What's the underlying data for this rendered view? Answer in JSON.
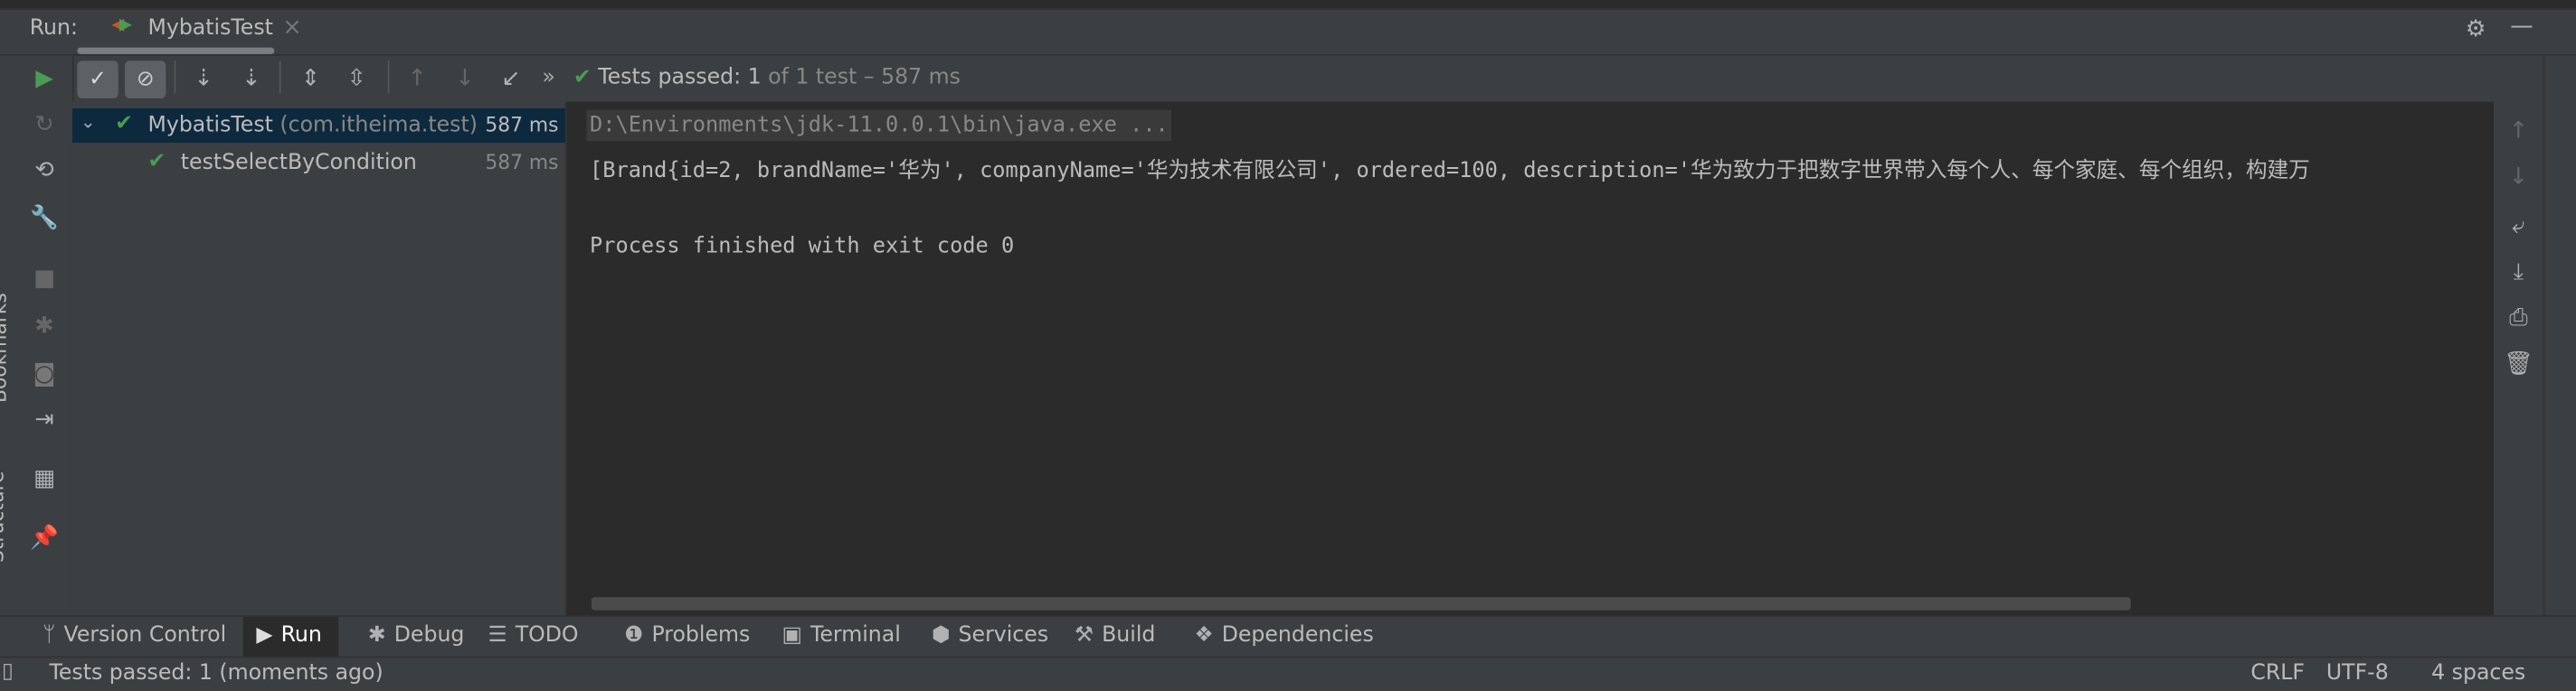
{
  "run_header": {
    "label": "Run:",
    "tab": "MybatisTest",
    "close": "×"
  },
  "toolbar": {
    "status_prefix": "Tests passed: ",
    "passed": "1",
    "status_suffix": " of 1 test – 587 ms",
    "more": "»"
  },
  "tree": [
    {
      "name": "MybatisTest",
      "pkg": " (com.itheima.test)",
      "time": "587 ms",
      "selected": true
    },
    {
      "name": "testSelectByCondition",
      "time": "587 ms"
    }
  ],
  "console": {
    "cmd": "D:\\Environments\\jdk-11.0.0.1\\bin\\java.exe ...",
    "output": "[Brand{id=2, brandName='华为', companyName='华为技术有限公司', ordered=100, description='华为致力于把数字世界带入每个人、每个家庭、每个组织，构建万",
    "exit": "Process finished with exit code 0"
  },
  "side_labels": {
    "bookmarks": "Bookmarks",
    "structure": "Structure"
  },
  "tool_windows": [
    {
      "label": "Version Control",
      "icon": "branch-icon"
    },
    {
      "label": "Run",
      "icon": "run-icon",
      "active": true
    },
    {
      "label": "Debug",
      "icon": "bug-icon"
    },
    {
      "label": "TODO",
      "icon": "list-icon"
    },
    {
      "label": "Problems",
      "icon": "problems-icon"
    },
    {
      "label": "Terminal",
      "icon": "terminal-icon"
    },
    {
      "label": "Services",
      "icon": "services-icon"
    },
    {
      "label": "Build",
      "icon": "hammer-icon"
    },
    {
      "label": "Dependencies",
      "icon": "dependencies-icon"
    }
  ],
  "status_bar": {
    "message": "Tests passed: 1 (moments ago)",
    "line_sep": "CRLF",
    "encoding": "UTF-8",
    "indent": "4 spaces"
  },
  "colors": {
    "bg": "#3c3f41",
    "console_bg": "#2b2b2b",
    "selected": "#0d293e",
    "pass": "#499c54"
  }
}
